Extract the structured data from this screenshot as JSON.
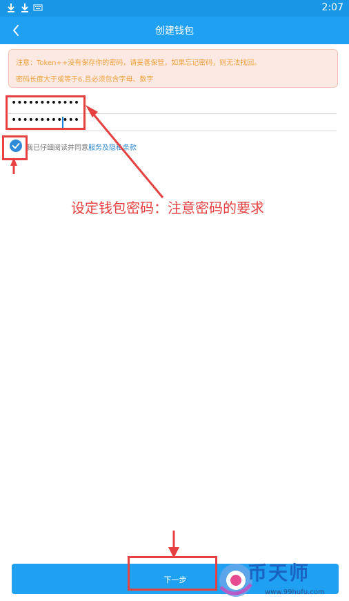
{
  "status_bar": {
    "time": "2:07",
    "icons": [
      "download-icon",
      "download-icon",
      "keyboard-icon"
    ]
  },
  "app_bar": {
    "back_icon": "back-arrow-icon",
    "title": "创建钱包"
  },
  "notice": {
    "line1": "注意：Token++没有保存你的密码，请妥善保管，如果忘记密码，则无法找回。",
    "line2": "密码长度大于或等于6,且必须包含字母、数字"
  },
  "password_field": {
    "value_masked": "••••••••••••"
  },
  "confirm_password_field": {
    "value_masked": "••••••••••••"
  },
  "agreement": {
    "text": "我已仔细阅读并同意",
    "link": "服务及隐私条款",
    "checked": true
  },
  "annotation": {
    "text": "设定钱包密码：注意密码的要求"
  },
  "next_button": {
    "label": "下一步"
  },
  "watermark": {
    "brand": "币天师",
    "url": "www.99hufu.com"
  },
  "colors": {
    "accent": "#1fa0f0",
    "status_bar": "#1a96e6",
    "notice_bg": "#fde9e3",
    "notice_text": "#f0a23c",
    "annotation": "#e64040",
    "link": "#2f8ad9"
  }
}
